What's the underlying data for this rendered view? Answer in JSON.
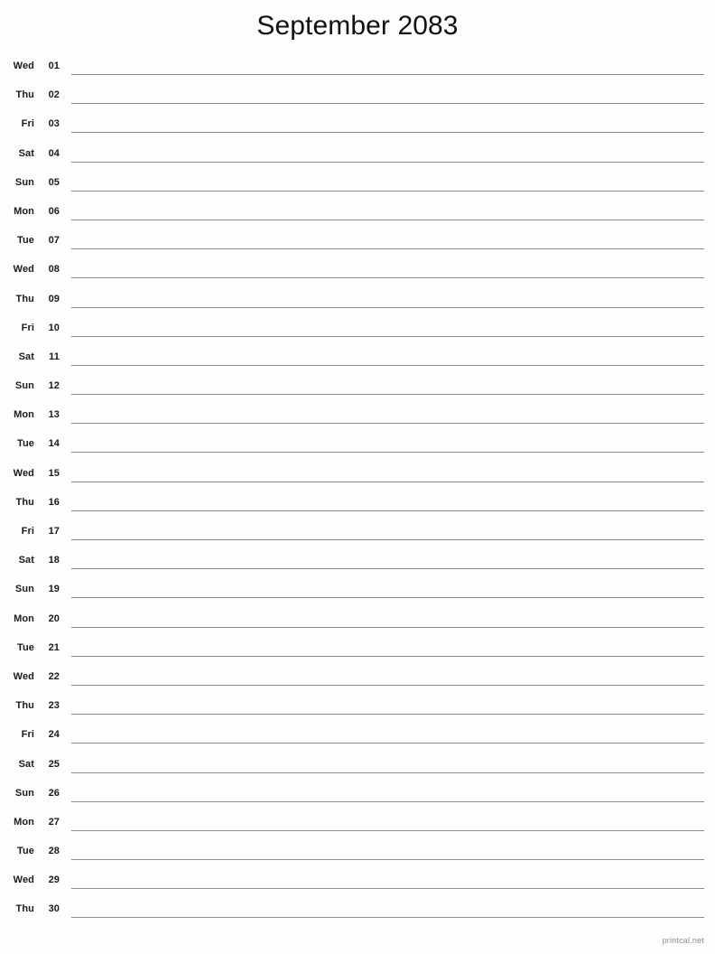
{
  "header": {
    "title": "September 2083",
    "month": "September",
    "year": "2083"
  },
  "footer": {
    "credit": "printcal.net"
  },
  "colors": {
    "page_background": "#fdfdfb",
    "title_text": "#111111",
    "row_text": "#1a1a1a",
    "rule_line": "#8a8a86",
    "footer_text": "#8c8c8c"
  },
  "calendar": {
    "layout": "single-column-notes",
    "days_in_month": 30,
    "rows": [
      {
        "weekday": "Wed",
        "date": "01"
      },
      {
        "weekday": "Thu",
        "date": "02"
      },
      {
        "weekday": "Fri",
        "date": "03"
      },
      {
        "weekday": "Sat",
        "date": "04"
      },
      {
        "weekday": "Sun",
        "date": "05"
      },
      {
        "weekday": "Mon",
        "date": "06"
      },
      {
        "weekday": "Tue",
        "date": "07"
      },
      {
        "weekday": "Wed",
        "date": "08"
      },
      {
        "weekday": "Thu",
        "date": "09"
      },
      {
        "weekday": "Fri",
        "date": "10"
      },
      {
        "weekday": "Sat",
        "date": "11"
      },
      {
        "weekday": "Sun",
        "date": "12"
      },
      {
        "weekday": "Mon",
        "date": "13"
      },
      {
        "weekday": "Tue",
        "date": "14"
      },
      {
        "weekday": "Wed",
        "date": "15"
      },
      {
        "weekday": "Thu",
        "date": "16"
      },
      {
        "weekday": "Fri",
        "date": "17"
      },
      {
        "weekday": "Sat",
        "date": "18"
      },
      {
        "weekday": "Sun",
        "date": "19"
      },
      {
        "weekday": "Mon",
        "date": "20"
      },
      {
        "weekday": "Tue",
        "date": "21"
      },
      {
        "weekday": "Wed",
        "date": "22"
      },
      {
        "weekday": "Thu",
        "date": "23"
      },
      {
        "weekday": "Fri",
        "date": "24"
      },
      {
        "weekday": "Sat",
        "date": "25"
      },
      {
        "weekday": "Sun",
        "date": "26"
      },
      {
        "weekday": "Mon",
        "date": "27"
      },
      {
        "weekday": "Tue",
        "date": "28"
      },
      {
        "weekday": "Wed",
        "date": "29"
      },
      {
        "weekday": "Thu",
        "date": "30"
      }
    ]
  }
}
